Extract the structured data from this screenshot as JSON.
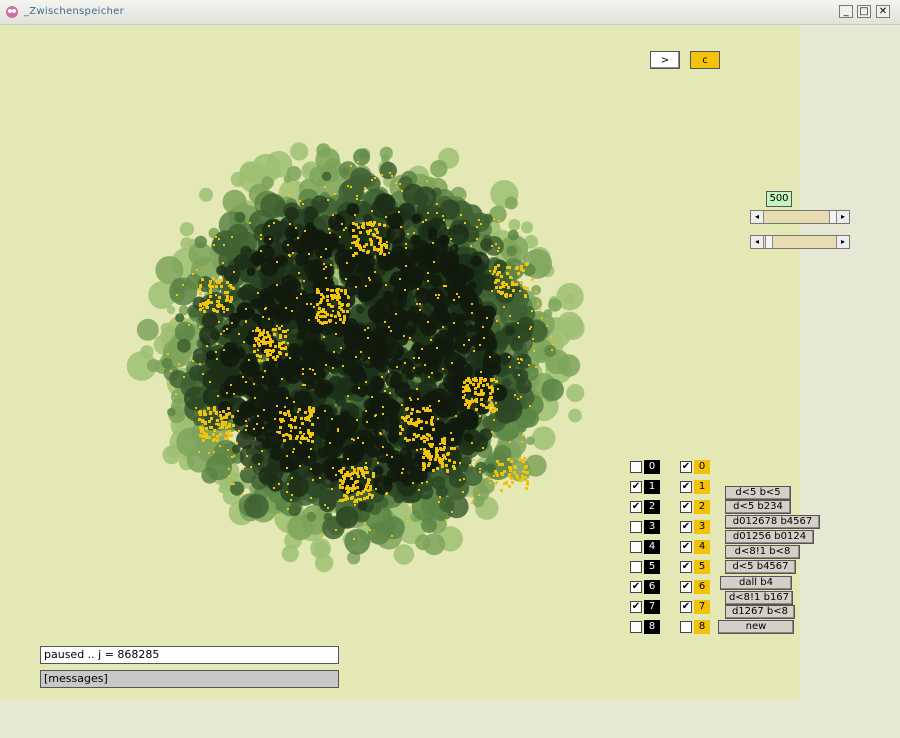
{
  "window": {
    "title": "_Zwischenspeicher",
    "minimize": "_",
    "maximize": "□",
    "close": "✕"
  },
  "controls": {
    "play_label": ">",
    "c_label": "c",
    "speed_value": "500"
  },
  "columns": {
    "left": [
      {
        "num": "0",
        "checked": false
      },
      {
        "num": "1",
        "checked": true
      },
      {
        "num": "2",
        "checked": true
      },
      {
        "num": "3",
        "checked": false
      },
      {
        "num": "4",
        "checked": false
      },
      {
        "num": "5",
        "checked": false
      },
      {
        "num": "6",
        "checked": true
      },
      {
        "num": "7",
        "checked": true
      },
      {
        "num": "8",
        "checked": false
      }
    ],
    "right": [
      {
        "num": "0",
        "checked": true
      },
      {
        "num": "1",
        "checked": true
      },
      {
        "num": "2",
        "checked": true
      },
      {
        "num": "3",
        "checked": true
      },
      {
        "num": "4",
        "checked": true
      },
      {
        "num": "5",
        "checked": true
      },
      {
        "num": "6",
        "checked": true
      },
      {
        "num": "7",
        "checked": true
      },
      {
        "num": "8",
        "checked": false
      }
    ]
  },
  "rules": [
    "d<5 b<5",
    "d<5 b234",
    "d012678 b4567",
    "d01256 b0124",
    "d<8!1 b<8",
    "d<5 b4567",
    "dall b4",
    "d<8!1 b167",
    "d1267 b<8",
    "new"
  ],
  "status": {
    "text": "paused .. j = 868285",
    "messages": "[messages]"
  },
  "colors": {
    "canvas_bg": "#e3e8b4",
    "accent_yellow": "#f3c20b",
    "dark_green": "#1c2a18",
    "mid_green": "#4f7a3c",
    "light_green": "#9fbf73"
  }
}
